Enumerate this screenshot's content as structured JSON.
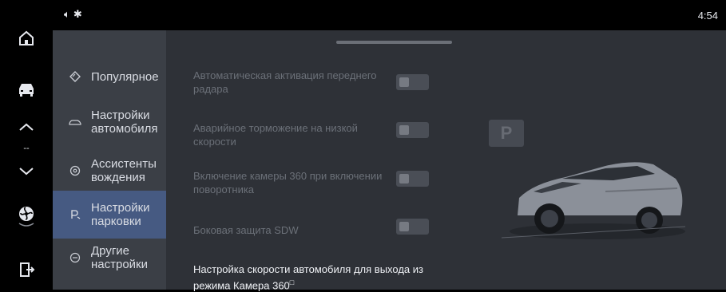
{
  "status_bar": {
    "time": "4:54",
    "icons": [
      "volume-icon",
      "bluetooth-icon"
    ]
  },
  "rail": {
    "icons": [
      "home-icon",
      "car-icon",
      "chevron-up-icon",
      "chevron-down-icon",
      "fan-icon",
      "exit-icon"
    ],
    "divider": "--"
  },
  "menu": {
    "items": [
      {
        "label": "Популярное",
        "icon": "diamond-icon",
        "active": false
      },
      {
        "label": "Настройки\nавтомобиля",
        "icon": "car-outline-icon",
        "active": false
      },
      {
        "label": "Ассистенты\nвождения",
        "icon": "steering-wheel-icon",
        "active": false
      },
      {
        "label": "Настройки\nпарковки",
        "icon": "parking-icon",
        "active": true
      },
      {
        "label": "Другие\nнастройки",
        "icon": "more-icon",
        "active": false
      }
    ]
  },
  "settings": [
    {
      "label": "Автоматическая активация переднего радара",
      "enabled": false
    },
    {
      "label": "Аварийное торможение на низкой скорости",
      "enabled": false
    },
    {
      "label": "Включение камеры 360 при включении поворотника",
      "enabled": false
    },
    {
      "label": "Боковая защита SDW",
      "enabled": false
    }
  ],
  "speed_setting": {
    "label": "Настройка скорости автомобиля для выхода из режима Камера 360",
    "info_icon": "info-icon"
  },
  "parking_badge": "P",
  "colors": {
    "active": "#465a82",
    "panel": "#3b3f46",
    "content": "#2e3137",
    "car": "#8b9099"
  }
}
